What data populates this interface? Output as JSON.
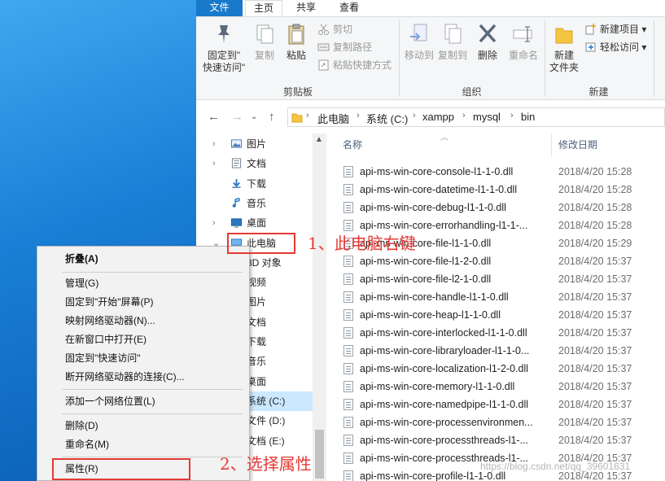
{
  "ribbon": {
    "tabs": [
      "文件",
      "主页",
      "共享",
      "查看"
    ],
    "clipboard": {
      "pin_label_1": "固定到\"",
      "pin_label_2": "快速访问\"",
      "copy": "复制",
      "paste": "粘贴",
      "cut": "剪切",
      "copy_path": "复制路径",
      "paste_shortcut": "粘贴快捷方式",
      "group": "剪贴板"
    },
    "organize": {
      "move_to": "移动到",
      "copy_to": "复制到",
      "delete": "删除",
      "rename": "重命名",
      "group": "组织"
    },
    "new": {
      "new_folder_1": "新建",
      "new_folder_2": "文件夹",
      "new_item": "新建项目 ▾",
      "easy_access": "轻松访问 ▾",
      "group": "新建"
    }
  },
  "address": {
    "crumbs": [
      "此电脑",
      "系统 (C:)",
      "xampp",
      "mysql",
      "bin"
    ]
  },
  "nav": {
    "items": [
      {
        "label": "图片",
        "icon": "pictures-icon"
      },
      {
        "label": "文档",
        "icon": "documents-icon"
      },
      {
        "label": "下载",
        "icon": "downloads-icon"
      },
      {
        "label": "音乐",
        "icon": "music-icon"
      },
      {
        "label": "桌面",
        "icon": "desktop-icon"
      },
      {
        "label": "此电脑",
        "icon": "computer-icon"
      },
      {
        "label": "3D 对象",
        "icon": "3d-objects-icon"
      },
      {
        "label": "视频",
        "icon": "videos-icon"
      },
      {
        "label": "图片",
        "icon": "pictures-icon"
      },
      {
        "label": "文档",
        "icon": "documents-icon"
      },
      {
        "label": "下载",
        "icon": "downloads-icon"
      },
      {
        "label": "音乐",
        "icon": "music-icon"
      },
      {
        "label": "桌面",
        "icon": "desktop-icon"
      },
      {
        "label": "系统 (C:)",
        "icon": "drive-icon"
      },
      {
        "label": "文件 (D:)",
        "icon": "drive-icon"
      },
      {
        "label": "文档 (E:)",
        "icon": "drive-icon"
      }
    ]
  },
  "files": {
    "col_name": "名称",
    "col_date": "修改日期",
    "rows": [
      {
        "name": "api-ms-win-core-console-l1-1-0.dll",
        "date": "2018/4/20 15:28"
      },
      {
        "name": "api-ms-win-core-datetime-l1-1-0.dll",
        "date": "2018/4/20 15:28"
      },
      {
        "name": "api-ms-win-core-debug-l1-1-0.dll",
        "date": "2018/4/20 15:28"
      },
      {
        "name": "api-ms-win-core-errorhandling-l1-1-...",
        "date": "2018/4/20 15:28"
      },
      {
        "name": "api-ms-win-core-file-l1-1-0.dll",
        "date": "2018/4/20 15:29"
      },
      {
        "name": "api-ms-win-core-file-l1-2-0.dll",
        "date": "2018/4/20 15:37"
      },
      {
        "name": "api-ms-win-core-file-l2-1-0.dll",
        "date": "2018/4/20 15:37"
      },
      {
        "name": "api-ms-win-core-handle-l1-1-0.dll",
        "date": "2018/4/20 15:37"
      },
      {
        "name": "api-ms-win-core-heap-l1-1-0.dll",
        "date": "2018/4/20 15:37"
      },
      {
        "name": "api-ms-win-core-interlocked-l1-1-0.dll",
        "date": "2018/4/20 15:37"
      },
      {
        "name": "api-ms-win-core-libraryloader-l1-1-0...",
        "date": "2018/4/20 15:37"
      },
      {
        "name": "api-ms-win-core-localization-l1-2-0.dll",
        "date": "2018/4/20 15:37"
      },
      {
        "name": "api-ms-win-core-memory-l1-1-0.dll",
        "date": "2018/4/20 15:37"
      },
      {
        "name": "api-ms-win-core-namedpipe-l1-1-0.dll",
        "date": "2018/4/20 15:37"
      },
      {
        "name": "api-ms-win-core-processenvironmen...",
        "date": "2018/4/20 15:37"
      },
      {
        "name": "api-ms-win-core-processthreads-l1-...",
        "date": "2018/4/20 15:37"
      },
      {
        "name": "api-ms-win-core-processthreads-l1-...",
        "date": "2018/4/20 15:37"
      },
      {
        "name": "api-ms-win-core-profile-l1-1-0.dll",
        "date": "2018/4/20 15:37"
      }
    ]
  },
  "context_menu": {
    "collapse": "折叠(A)",
    "manage": "管理(G)",
    "pin_start": "固定到\"开始\"屏幕(P)",
    "map_drive": "映射网络驱动器(N)...",
    "open_new_window": "在新窗口中打开(E)",
    "pin_quick": "固定到\"快速访问\"",
    "disconnect_drive": "断开网络驱动器的连接(C)...",
    "add_network_location": "添加一个网络位置(L)",
    "delete": "删除(D)",
    "rename": "重命名(M)",
    "properties": "属性(R)"
  },
  "annotations": {
    "step1": "1、此电脑右键",
    "step2": "2、选择属性"
  },
  "watermark": "https://blog.csdn.net/qq_39601631",
  "colors": {
    "accent": "#1979ca",
    "selected": "#cce8ff",
    "annotation": "#e53935"
  }
}
